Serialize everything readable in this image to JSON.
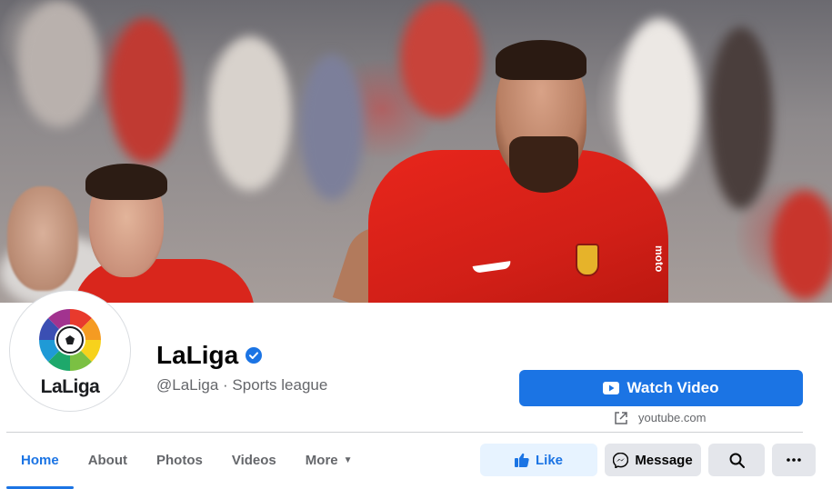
{
  "page": {
    "name": "LaLiga",
    "verified": true,
    "handle_line": "@LaLiga · Sports league",
    "logo_text": "LaLiga"
  },
  "cover": {
    "sponsor_text": "moto"
  },
  "primary_action": {
    "label": "Watch Video",
    "link_text": "youtube.com"
  },
  "tabs": [
    {
      "label": "Home",
      "active": true
    },
    {
      "label": "About"
    },
    {
      "label": "Photos"
    },
    {
      "label": "Videos"
    },
    {
      "label": "More"
    }
  ],
  "actions": {
    "like_label": "Like",
    "message_label": "Message"
  },
  "colors": {
    "accent": "#1b74e4",
    "like_bg": "#e7f3ff",
    "button_bg": "#e4e6eb",
    "secondary_text": "#65676b"
  }
}
